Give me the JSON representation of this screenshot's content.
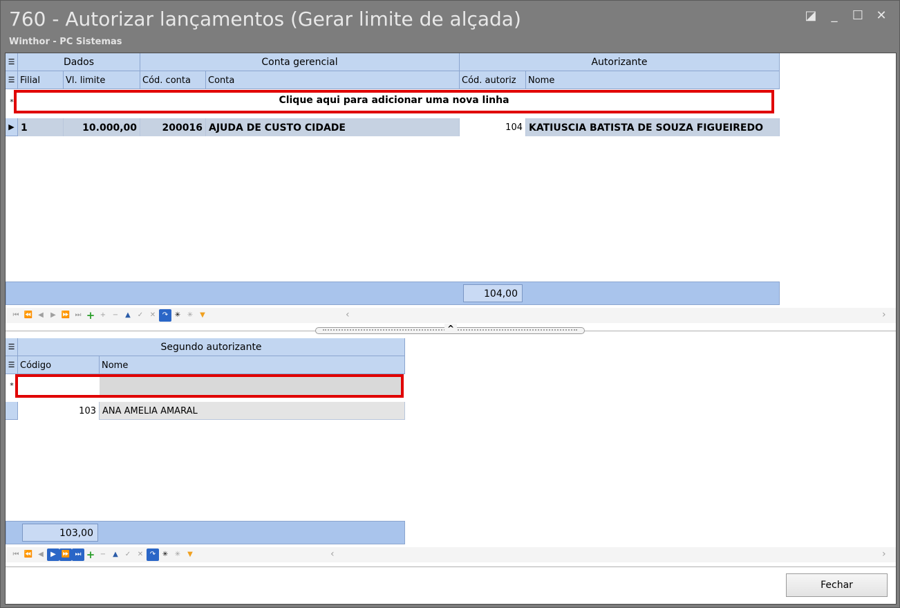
{
  "window": {
    "title": "760 - Autorizar lançamentos (Gerar limite de alçada)",
    "subtitle": "Winthor - PC Sistemas",
    "buttons": [
      "restore",
      "minimize",
      "maximize",
      "close"
    ]
  },
  "grid_top": {
    "bands": {
      "dados": "Dados",
      "conta": "Conta gerencial",
      "autorizante": "Autorizante"
    },
    "columns": {
      "filial": "Filial",
      "vl_limite": "Vl. limite",
      "cod_conta": "Cód. conta",
      "conta": "Conta",
      "cod_autoriz": "Cód. autoriz",
      "nome": "Nome"
    },
    "new_row_text": "Clique aqui para adicionar uma nova linha",
    "rows": [
      {
        "filial": "1",
        "vl_limite": "10.000,00",
        "cod_conta": "200016",
        "conta": "AJUDA DE CUSTO CIDADE",
        "cod_autoriz": "104",
        "nome": "KATIUSCIA BATISTA DE SOUZA FIGUEIREDO"
      }
    ],
    "summary": "104,00"
  },
  "grid_bottom": {
    "band": "Segundo autorizante",
    "columns": {
      "codigo": "Código",
      "nome": "Nome"
    },
    "rows": [
      {
        "codigo": "103",
        "nome": "ANA AMELIA AMARAL"
      }
    ],
    "summary": "103,00"
  },
  "actions": {
    "fechar": "Fechar"
  },
  "colors": {
    "titlebar": "#7d7d7d",
    "header": "#c2d6f1",
    "footer": "#a9c4ec",
    "highlight_border": "#e00000"
  }
}
